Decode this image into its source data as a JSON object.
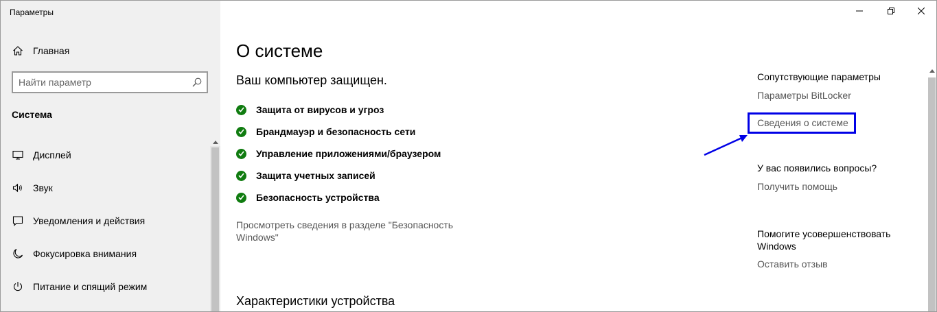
{
  "window": {
    "title": "Параметры",
    "controls": {
      "minimize": "minimize-icon",
      "restore": "restore-icon",
      "close": "close-icon"
    }
  },
  "sidebar": {
    "home_label": "Главная",
    "search_placeholder": "Найти параметр",
    "section_heading": "Система",
    "items": [
      {
        "label": "Дисплей",
        "icon": "monitor-icon"
      },
      {
        "label": "Звук",
        "icon": "speaker-icon"
      },
      {
        "label": "Уведомления и действия",
        "icon": "notification-icon"
      },
      {
        "label": "Фокусировка внимания",
        "icon": "moon-icon"
      },
      {
        "label": "Питание и спящий режим",
        "icon": "power-icon"
      }
    ]
  },
  "main": {
    "title": "О системе",
    "protection_heading": "Ваш компьютер защищен.",
    "checks": [
      "Защита от вирусов и угроз",
      "Брандмауэр и безопасность сети",
      "Управление приложениями/браузером",
      "Защита учетных записей",
      "Безопасность устройства"
    ],
    "security_link": "Просмотреть сведения в разделе \"Безопасность Windows\"",
    "device_heading": "Характеристики устройства"
  },
  "related": {
    "heading": "Сопутствующие параметры",
    "bitlocker_link": "Параметры BitLocker",
    "system_info_link": "Сведения о системе",
    "questions_heading": "У вас появились вопросы?",
    "help_link": "Получить помощь",
    "improve_heading": "Помогите усовершенствовать Windows",
    "feedback_link": "Оставить отзыв"
  },
  "colors": {
    "accent_check": "#107c10",
    "annotation": "#0000e6",
    "sidebar_bg": "#f0f0f0"
  }
}
